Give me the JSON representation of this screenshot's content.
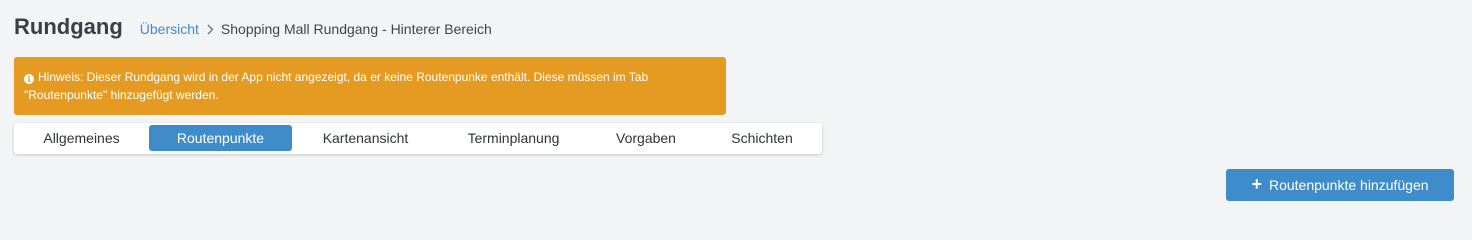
{
  "header": {
    "title": "Rundgang",
    "breadcrumb": {
      "link_label": "Übersicht",
      "separator_icon": "chevron-right-icon",
      "current": "Shopping Mall Rundgang - Hinterer Bereich"
    }
  },
  "alert": {
    "icon": "info-icon",
    "icon_glyph": "i",
    "text": "Hinweis: Dieser Rundgang wird in der App nicht angezeigt, da er keine Routenpunke enthält. Diese müssen im Tab \"Routenpunkte\" hinzugefügt werden.",
    "color": "#e59b22"
  },
  "tabs": [
    {
      "label": "Allgemeines",
      "active": false
    },
    {
      "label": "Routenpunkte",
      "active": true
    },
    {
      "label": "Kartenansicht",
      "active": false
    },
    {
      "label": "Terminplanung",
      "active": false
    },
    {
      "label": "Vorgaben",
      "active": false
    },
    {
      "label": "Schichten",
      "active": false
    }
  ],
  "actions": {
    "add_button_icon": "plus-icon",
    "add_button_glyph": "+",
    "add_button_label": "Routenpunkte hinzufügen"
  },
  "colors": {
    "accent": "#3f8ccb",
    "link": "#3d8bc9",
    "warning": "#e59b22",
    "background": "#f3f4f6"
  }
}
